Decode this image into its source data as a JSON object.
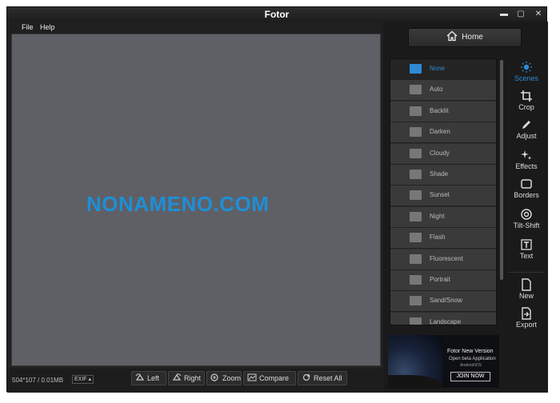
{
  "window": {
    "title": "Fotor",
    "controls": {
      "minimize": "▬",
      "maximize": "▢",
      "close": "✕"
    }
  },
  "menu": {
    "items": [
      "File",
      "Help"
    ]
  },
  "canvas": {
    "watermark": "NONAMENO.COM"
  },
  "status": {
    "size_text": "504*107 / 0.01MB",
    "exif_label": "EXIF ▴"
  },
  "tools": {
    "left": "Left",
    "right": "Right",
    "zoom": "Zoom",
    "compare": "Compare",
    "reset": "Reset All"
  },
  "home_button": {
    "label": "Home"
  },
  "scenes": {
    "items": [
      {
        "label": "None",
        "active": true
      },
      {
        "label": "Auto",
        "active": false
      },
      {
        "label": "Backlit",
        "active": false
      },
      {
        "label": "Darken",
        "active": false
      },
      {
        "label": "Cloudy",
        "active": false
      },
      {
        "label": "Shade",
        "active": false
      },
      {
        "label": "Sunset",
        "active": false
      },
      {
        "label": "Night",
        "active": false
      },
      {
        "label": "Flash",
        "active": false
      },
      {
        "label": "Fluorescent",
        "active": false
      },
      {
        "label": "Portrait",
        "active": false
      },
      {
        "label": "Sand/Snow",
        "active": false
      },
      {
        "label": "Landscape",
        "active": false
      }
    ]
  },
  "ad": {
    "title": "Fotor New Version",
    "subtitle": "Open beta Application",
    "platform": "Android/iOS",
    "button": "JOIN NOW"
  },
  "toolbar": {
    "tabs": [
      {
        "label": "Scenes",
        "icon": "sun-icon",
        "active": true
      },
      {
        "label": "Crop",
        "icon": "crop-icon",
        "active": false
      },
      {
        "label": "Adjust",
        "icon": "pen-icon",
        "active": false
      },
      {
        "label": "Effects",
        "icon": "sparkle-icon",
        "active": false
      },
      {
        "label": "Borders",
        "icon": "border-icon",
        "active": false
      },
      {
        "label": "Tilt-Shift",
        "icon": "tiltshift-icon",
        "active": false
      },
      {
        "label": "Text",
        "icon": "text-icon",
        "active": false
      },
      {
        "label": "New",
        "icon": "new-file-icon",
        "active": false
      },
      {
        "label": "Export",
        "icon": "export-icon",
        "active": false
      }
    ]
  },
  "colors": {
    "accent": "#2f8ad4",
    "watermark": "#1e8fd6",
    "canvas": "#5f6066"
  }
}
